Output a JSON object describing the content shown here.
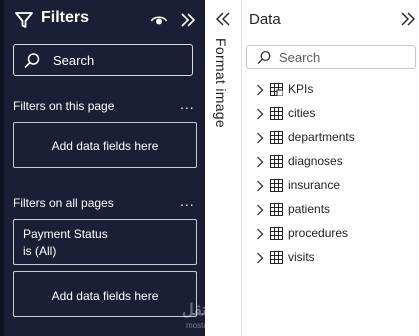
{
  "filters": {
    "title": "Filters",
    "search_placeholder": "Search",
    "on_this_page": {
      "label": "Filters on this page",
      "more": "...",
      "well": "Add data fields here"
    },
    "on_all_pages": {
      "label": "Filters on all pages",
      "more": "...",
      "card": {
        "field": "Payment Status",
        "state": "is (All)"
      },
      "well": "Add data fields here"
    }
  },
  "format_strip": {
    "label": "Format image"
  },
  "data_pane": {
    "title": "Data",
    "search_placeholder": "Search",
    "tables": [
      {
        "label": "KPIs",
        "icon": "measure-table-icon"
      },
      {
        "label": "cities",
        "icon": "table-icon"
      },
      {
        "label": "departments",
        "icon": "table-icon"
      },
      {
        "label": "diagnoses",
        "icon": "table-icon"
      },
      {
        "label": "insurance",
        "icon": "table-icon"
      },
      {
        "label": "patients",
        "icon": "table-icon"
      },
      {
        "label": "procedures",
        "icon": "table-icon"
      },
      {
        "label": "visits",
        "icon": "table-icon"
      }
    ]
  },
  "watermark": {
    "text": "مستقل",
    "sub": "mostaql.com"
  },
  "colors": {
    "filters_bg": "#1b1f36",
    "text_dark": "#252423"
  }
}
